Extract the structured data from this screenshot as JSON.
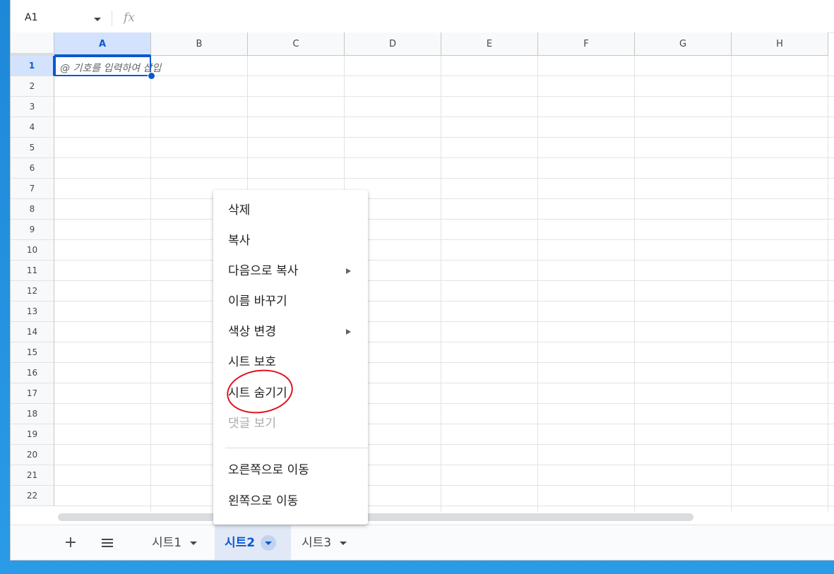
{
  "formula_bar": {
    "cell_reference": "A1",
    "fx_label": "fx"
  },
  "grid": {
    "columns": [
      "A",
      "B",
      "C",
      "D",
      "E",
      "F",
      "G",
      "H"
    ],
    "rows": [
      "1",
      "2",
      "3",
      "4",
      "5",
      "6",
      "7",
      "8",
      "9",
      "10",
      "11",
      "12",
      "13",
      "14",
      "15",
      "16",
      "17",
      "18",
      "19",
      "20",
      "21",
      "22"
    ],
    "selected_cell": "A1",
    "a1_hint": "@ 기호를 입력하여 삽입"
  },
  "sheet_bar": {
    "add_label": "+",
    "tabs": [
      {
        "label": "시트1"
      },
      {
        "label": "시트2"
      },
      {
        "label": "시트3"
      }
    ],
    "active_tab": "시트2"
  },
  "context_menu": {
    "items": [
      {
        "label": "삭제",
        "has_submenu": false,
        "disabled": false
      },
      {
        "label": "복사",
        "has_submenu": false,
        "disabled": false
      },
      {
        "label": "다음으로 복사",
        "has_submenu": true,
        "disabled": false
      },
      {
        "label": "이름 바꾸기",
        "has_submenu": false,
        "disabled": false
      },
      {
        "label": "색상 변경",
        "has_submenu": true,
        "disabled": false
      },
      {
        "label": "시트 보호",
        "has_submenu": false,
        "disabled": false
      },
      {
        "label": "시트 숨기기",
        "has_submenu": false,
        "disabled": false
      },
      {
        "label": "댓글 보기",
        "has_submenu": false,
        "disabled": true
      },
      {
        "label": "오른쪽으로 이동",
        "has_submenu": false,
        "disabled": false
      },
      {
        "label": "왼쪽으로 이동",
        "has_submenu": false,
        "disabled": false
      }
    ],
    "highlighted_item": "시트 숨기기"
  },
  "colors": {
    "selection_blue": "#0b57d0",
    "annotation_red": "#e0121f",
    "desktop_blue": "#1e88d8"
  }
}
